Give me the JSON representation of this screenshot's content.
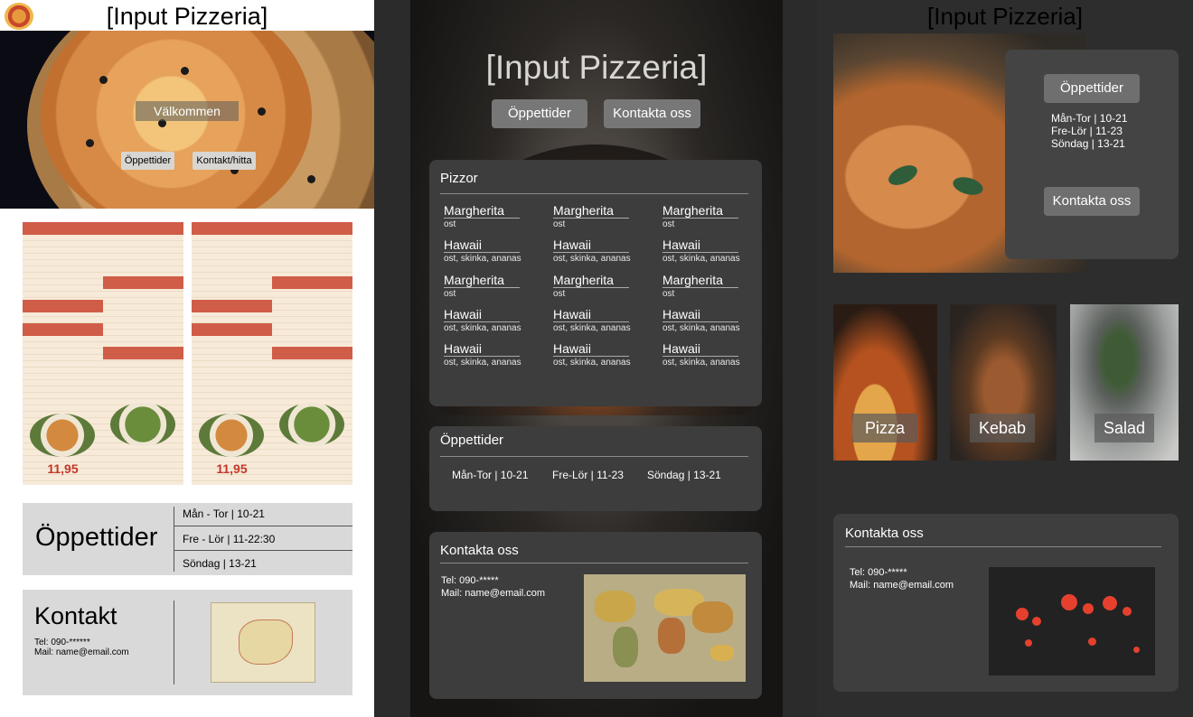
{
  "panel1": {
    "title": "[Input Pizzeria]",
    "welcome": "Välkommen",
    "buttons": {
      "hours": "Öppettider",
      "contact": "Kontakt/hitta"
    },
    "menu_prices": [
      "11,95",
      "11,95"
    ],
    "hours": {
      "heading": "Öppettider",
      "lines": [
        "Mån - Tor | 10-21",
        "Fre - Lör | 11-22:30",
        "Söndag | 13-21"
      ]
    },
    "contact": {
      "heading": "Kontakt",
      "tel": "Tel: 090-******",
      "mail": "Mail: name@email.com"
    }
  },
  "panel3": {
    "title": "[Input Pizzeria]",
    "buttons": {
      "hours": "Öppettider",
      "contact": "Kontakta oss"
    },
    "pizzor": {
      "heading": "Pizzor",
      "items": [
        {
          "name": "Margherita",
          "desc": "ost"
        },
        {
          "name": "Margherita",
          "desc": "ost"
        },
        {
          "name": "Margherita",
          "desc": "ost"
        },
        {
          "name": "Hawaii",
          "desc": "ost, skinka, ananas"
        },
        {
          "name": "Hawaii",
          "desc": "ost, skinka, ananas"
        },
        {
          "name": "Hawaii",
          "desc": "ost, skinka, ananas"
        },
        {
          "name": "Margherita",
          "desc": "ost"
        },
        {
          "name": "Margherita",
          "desc": "ost"
        },
        {
          "name": "Margherita",
          "desc": "ost"
        },
        {
          "name": "Hawaii",
          "desc": "ost, skinka, ananas"
        },
        {
          "name": "Hawaii",
          "desc": "ost, skinka, ananas"
        },
        {
          "name": "Hawaii",
          "desc": "ost, skinka, ananas"
        },
        {
          "name": "Hawaii",
          "desc": "ost, skinka, ananas"
        },
        {
          "name": "Hawaii",
          "desc": "ost, skinka, ananas"
        },
        {
          "name": "Hawaii",
          "desc": "ost, skinka, ananas"
        }
      ]
    },
    "hours": {
      "heading": "Öppettider",
      "lines": [
        "Mån-Tor | 10-21",
        "Fre-Lör | 11-23",
        "Söndag | 13-21"
      ]
    },
    "contact": {
      "heading": "Kontakta oss",
      "tel": "Tel: 090-*****",
      "mail": "Mail: name@email.com"
    }
  },
  "panel5": {
    "title": "[Input Pizzeria]",
    "hours_button": "Öppettider",
    "hours_lines": [
      "Mån-Tor | 10-21",
      "Fre-Lör | 11-23",
      "Söndag | 13-21"
    ],
    "contact_button": "Kontakta oss",
    "categories": [
      "Pizza",
      "Kebab",
      "Salad"
    ],
    "contact": {
      "heading": "Kontakta oss",
      "tel": "Tel: 090-*****",
      "mail": "Mail: name@email.com"
    }
  }
}
